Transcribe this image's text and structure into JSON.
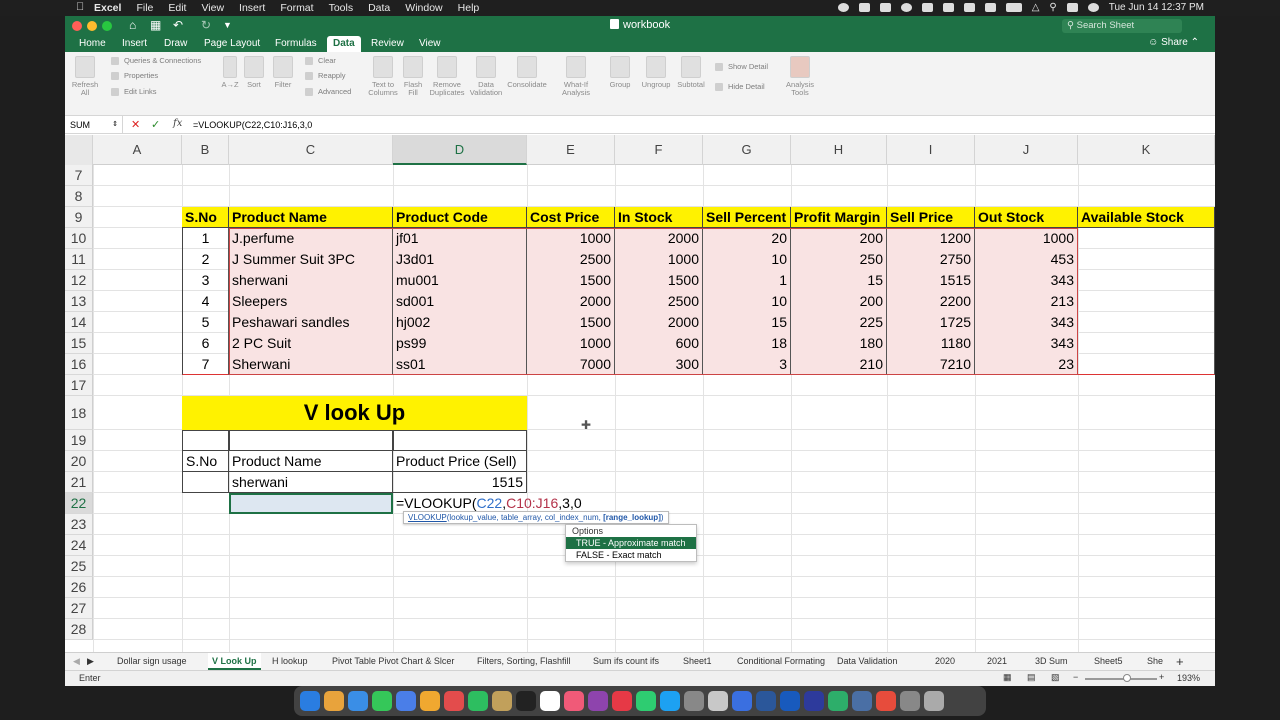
{
  "menubar": {
    "app": "Excel",
    "items": [
      "File",
      "Edit",
      "View",
      "Insert",
      "Format",
      "Tools",
      "Data",
      "Window",
      "Help"
    ],
    "clock": "Tue Jun 14  12:37 PM"
  },
  "window": {
    "title": "workbook",
    "search_placeholder": "Search Sheet",
    "share_label": "Share"
  },
  "ribbon_tabs": [
    "Home",
    "Insert",
    "Draw",
    "Page Layout",
    "Formulas",
    "Data",
    "Review",
    "View"
  ],
  "active_ribbon_tab": "Data",
  "ribbon": {
    "refresh_all": "Refresh All",
    "queries": "Queries & Connections",
    "properties": "Properties",
    "edit_links": "Edit Links",
    "sort_asc": "A→Z",
    "sort": "Sort",
    "filter": "Filter",
    "clear": "Clear",
    "reapply": "Reapply",
    "advanced": "Advanced",
    "text_to_columns": "Text to Columns",
    "flash_fill": "Flash Fill",
    "remove_duplicates": "Remove Duplicates",
    "data_validation": "Data Validation",
    "consolidate": "Consolidate",
    "what_if": "What-If Analysis",
    "group": "Group",
    "ungroup": "Ungroup",
    "subtotal": "Subtotal",
    "show_detail": "Show Detail",
    "hide_detail": "Hide Detail",
    "analysis_tools": "Analysis Tools"
  },
  "formula_bar": {
    "name_box": "SUM",
    "fx": "fx",
    "formula": "=VLOOKUP(C22,C10:J16,3,0"
  },
  "columns": [
    "A",
    "B",
    "C",
    "D",
    "E",
    "F",
    "G",
    "H",
    "I",
    "J",
    "K"
  ],
  "rows": [
    "7",
    "8",
    "9",
    "10",
    "11",
    "12",
    "13",
    "14",
    "15",
    "16",
    "17",
    "18",
    "19",
    "20",
    "21",
    "22",
    "23",
    "24",
    "25",
    "26",
    "27",
    "28"
  ],
  "table": {
    "headers": [
      "S.No",
      "Product Name",
      "Product Code",
      "Cost Price",
      "In Stock",
      "Sell Percent",
      "Profit Margin",
      "Sell Price",
      "Out Stock",
      "Available Stock"
    ],
    "rows": [
      [
        "1",
        "J.perfume",
        "jf01",
        "1000",
        "2000",
        "20",
        "200",
        "1200",
        "1000",
        ""
      ],
      [
        "2",
        "J Summer Suit 3PC",
        "J3d01",
        "2500",
        "1000",
        "10",
        "250",
        "2750",
        "453",
        ""
      ],
      [
        "3",
        "sherwani",
        "mu001",
        "1500",
        "1500",
        "1",
        "15",
        "1515",
        "343",
        ""
      ],
      [
        "4",
        "Sleepers",
        "sd001",
        "2000",
        "2500",
        "10",
        "200",
        "2200",
        "213",
        ""
      ],
      [
        "5",
        "Peshawari sandles",
        "hj002",
        "1500",
        "2000",
        "15",
        "225",
        "1725",
        "343",
        ""
      ],
      [
        "6",
        "2 PC Suit",
        "ps99",
        "1000",
        "600",
        "18",
        "180",
        "1180",
        "343",
        ""
      ],
      [
        "7",
        "Sherwani",
        "ss01",
        "7000",
        "300",
        "3",
        "210",
        "7210",
        "23",
        ""
      ]
    ]
  },
  "lookup": {
    "title": "V look Up",
    "h_sno": "S.No",
    "h_product": "Product Name",
    "h_price": "Product Price (Sell)",
    "product": "sherwani",
    "price": "1515",
    "edit_prefix": "=VLOOKUP(",
    "edit_ref1": "C22",
    "edit_comma": ",",
    "edit_ref2": "C10:J16",
    "edit_suffix": ",3,0"
  },
  "tooltip": {
    "fn": "VLOOKUP",
    "args": "(lookup_value, table_array, col_index_num, ",
    "bold_arg": "[range_lookup]",
    "close": ")"
  },
  "options": {
    "header": "Options",
    "items": [
      "TRUE - Approximate match",
      "FALSE - Exact match"
    ]
  },
  "sheets": [
    "Dollar sign usage",
    "V Look Up",
    "H lookup",
    "Pivot Table Pivot Chart & Slcer",
    "Filters, Sorting, Flashfill",
    "Sum ifs count ifs",
    "Sheet1",
    "Conditional Formating",
    "Data Validation",
    "2020",
    "2021",
    "3D Sum",
    "Sheet5",
    "She"
  ],
  "active_sheet": "V Look Up",
  "status": {
    "mode": "Enter",
    "zoom": "193%"
  }
}
